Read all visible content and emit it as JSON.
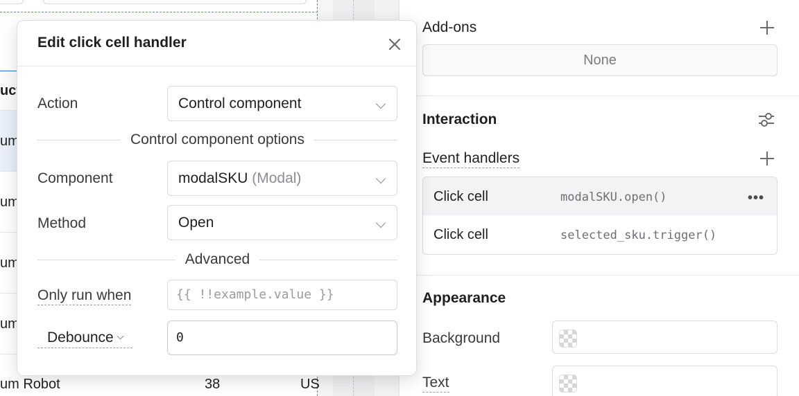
{
  "canvas": {
    "rows": [
      {
        "c1": "um",
        "c2": "",
        "c3": ""
      },
      {
        "c1": "um",
        "c2": "",
        "c3": ""
      },
      {
        "c1": "um",
        "c2": "",
        "c3": ""
      },
      {
        "c1": "um",
        "c2": "",
        "c3": ""
      },
      {
        "c1": "um Robot",
        "c2": "38",
        "c3": "US"
      }
    ],
    "header_text": "uct"
  },
  "inspector": {
    "addons": {
      "title": "Add-ons",
      "none_label": "None"
    },
    "interaction": {
      "title": "Interaction",
      "event_handlers_label": "Event handlers",
      "handlers": [
        {
          "event": "Click cell",
          "code": "modalSKU.open()",
          "more": "•••"
        },
        {
          "event": "Click cell",
          "code": "selected_sku.trigger()",
          "more": ""
        }
      ]
    },
    "appearance": {
      "title": "Appearance",
      "background_label": "Background",
      "text_label": "Text"
    }
  },
  "modal": {
    "title": "Edit click cell handler",
    "action_label": "Action",
    "action_value": "Control component",
    "options_heading": "Control component options",
    "component_label": "Component",
    "component_value": "modalSKU",
    "component_hint": "(Modal)",
    "method_label": "Method",
    "method_value": "Open",
    "advanced_heading": "Advanced",
    "only_run_label": "Only run when",
    "only_run_placeholder": "{{ !!example.value }}",
    "debounce_label": "Debounce",
    "debounce_value": "0"
  },
  "icons": {
    "close": "close-icon",
    "plus": "plus-icon",
    "tune": "sliders-icon",
    "chevron": "chevron-down-icon"
  },
  "colors": {
    "selection_border": "#2f6fd8",
    "selected_row": "#e9effb"
  }
}
